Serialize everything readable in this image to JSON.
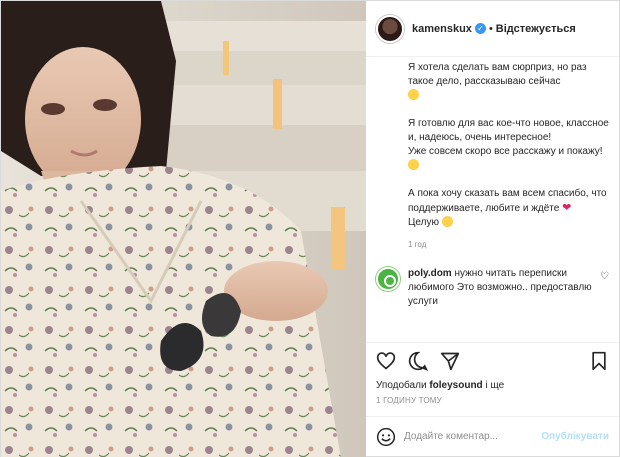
{
  "header": {
    "username": "kamenskux",
    "separator": "•",
    "follow_label": "Відстежується",
    "verified_icon": "verified-check-icon"
  },
  "caption": {
    "p1": "Я хотела сделать вам сюрприз, но раз такое дело, рассказываю сейчас",
    "p2": "Я готовлю для вас кое-что новое, классное и, надеюсь, очень интересное!",
    "p3": "Уже совсем скоро все расскажу и покажу!",
    "p4": "А пока хочу сказать вам всем спасибо, что поддерживаете, любите и ждёте",
    "p5": "Целую",
    "time": "1 год"
  },
  "comment": {
    "username": "poly.dom",
    "text": "нужно читать переписки любимого Это возможно.. предоставлю услуги"
  },
  "likes": {
    "prefix": "Уподобали",
    "user": "foleysound",
    "suffix": "і ще"
  },
  "timestamp": "1 ГОДИНУ ТОМУ",
  "add_comment": {
    "placeholder": "Додайте коментар...",
    "publish_label": "Опублікувати"
  },
  "colors": {
    "accent_blue": "#3897f0",
    "publish_disabled": "#b2dffc",
    "heart_red": "#e0245e",
    "muted_text": "#8e8e8e"
  }
}
